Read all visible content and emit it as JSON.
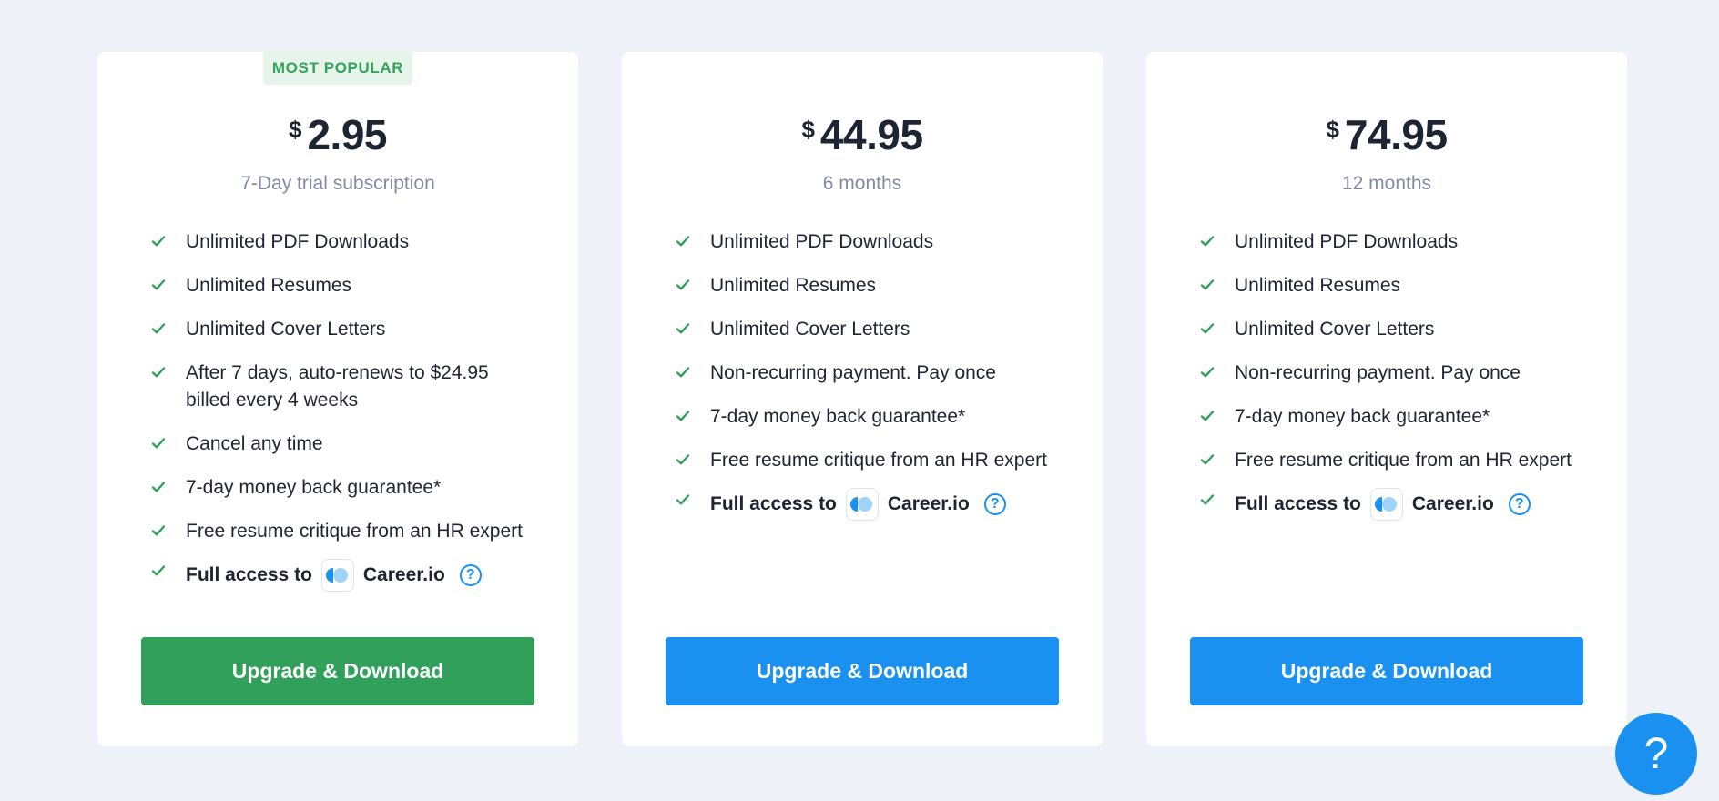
{
  "plans": [
    {
      "badge": "MOST POPULAR",
      "currency": "$",
      "price": "2.95",
      "period": "7-Day trial subscription",
      "features": [
        "Unlimited PDF Downloads",
        "Unlimited Resumes",
        "Unlimited Cover Letters",
        "After 7 days, auto-renews to $24.95 billed every 4 weeks",
        "Cancel any time",
        "7-day money back guarantee*",
        "Free resume critique from an HR expert"
      ],
      "access_label": "Full access to",
      "access_brand": "Career.io",
      "cta": "Upgrade & Download",
      "cta_color": "#30a05a"
    },
    {
      "currency": "$",
      "price": "44.95",
      "period": "6 months",
      "features": [
        "Unlimited PDF Downloads",
        "Unlimited Resumes",
        "Unlimited Cover Letters",
        "Non-recurring payment. Pay once",
        "7-day money back guarantee*",
        "Free resume critique from an HR expert"
      ],
      "access_label": "Full access to",
      "access_brand": "Career.io",
      "cta": "Upgrade & Download",
      "cta_color": "#1a91f0"
    },
    {
      "currency": "$",
      "price": "74.95",
      "period": "12 months",
      "features": [
        "Unlimited PDF Downloads",
        "Unlimited Resumes",
        "Unlimited Cover Letters",
        "Non-recurring payment. Pay once",
        "7-day money back guarantee*",
        "Free resume critique from an HR expert"
      ],
      "access_label": "Full access to",
      "access_brand": "Career.io",
      "cta": "Upgrade & Download",
      "cta_color": "#1a91f0"
    }
  ],
  "help_fab": "?",
  "icons": {
    "check": "check-icon",
    "brand_logo": "career-io-logo-icon",
    "help": "question-circle-icon"
  },
  "colors": {
    "page_bg": "#eef1f8",
    "check": "#30a05a",
    "badge_text": "#34a35c",
    "accent_blue": "#1a91f0"
  }
}
